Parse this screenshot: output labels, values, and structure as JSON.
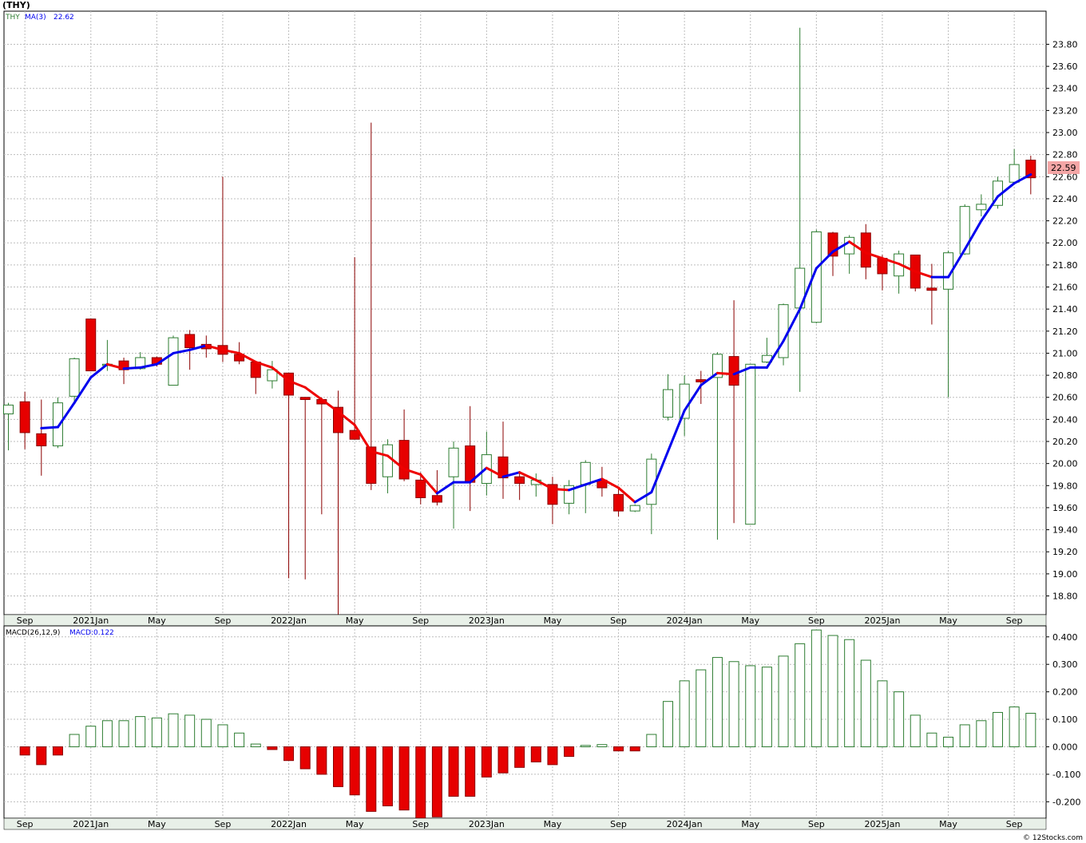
{
  "header": {
    "symbol_title": "(THY)",
    "price_legend_symbol": "THY",
    "ma_legend": "MA(3)",
    "ma_value": "22.62",
    "last_price_label": "22.59",
    "macd_legend": "MACD(26,12,9)",
    "macd_value_label": "MACD:0.122",
    "watermark": "© 12Stocks.com"
  },
  "colors": {
    "up_candle": "#2e7d32",
    "down_candle": "#e60000",
    "ma_up": "#0000ee",
    "ma_down": "#ee0000",
    "grid": "#bdbdbd",
    "last_price_bg": "#f4a6a6"
  },
  "x_axis": {
    "labels": [
      {
        "text": "Sep",
        "bar": 1
      },
      {
        "text": "2021Jan",
        "bar": 5
      },
      {
        "text": "May",
        "bar": 9
      },
      {
        "text": "Sep",
        "bar": 13
      },
      {
        "text": "2022Jan",
        "bar": 17
      },
      {
        "text": "May",
        "bar": 21
      },
      {
        "text": "Sep",
        "bar": 25
      },
      {
        "text": "2023Jan",
        "bar": 29
      },
      {
        "text": "May",
        "bar": 33
      },
      {
        "text": "Sep",
        "bar": 37
      },
      {
        "text": "2024Jan",
        "bar": 41
      },
      {
        "text": "May",
        "bar": 45
      },
      {
        "text": "Sep",
        "bar": 49
      },
      {
        "text": "2025Jan",
        "bar": 53
      },
      {
        "text": "May",
        "bar": 57
      },
      {
        "text": "Sep",
        "bar": 61
      }
    ]
  },
  "price_axis": {
    "min": 18.63,
    "max": 24.1,
    "ticks": [
      "18.80",
      "19.00",
      "19.20",
      "19.40",
      "19.60",
      "19.80",
      "20.00",
      "20.20",
      "20.40",
      "20.60",
      "20.80",
      "21.00",
      "21.20",
      "21.40",
      "21.60",
      "21.80",
      "22.00",
      "22.20",
      "22.40",
      "22.60",
      "22.80",
      "23.00",
      "23.20",
      "23.40",
      "23.60",
      "23.80"
    ]
  },
  "macd_axis": {
    "min": -0.26,
    "max": 0.44,
    "ticks": [
      "-0.200",
      "-0.100",
      "0.000",
      "0.100",
      "0.200",
      "0.300",
      "0.400"
    ]
  },
  "chart_data": [
    {
      "type": "candlestick",
      "title": "(THY)",
      "series_name": "THY",
      "period": "monthly",
      "candles": [
        {
          "o": 20.45,
          "h": 20.55,
          "l": 20.12,
          "c": 20.53
        },
        {
          "o": 20.56,
          "h": 20.65,
          "l": 20.13,
          "c": 20.28
        },
        {
          "o": 20.27,
          "h": 20.58,
          "l": 19.89,
          "c": 20.16
        },
        {
          "o": 20.16,
          "h": 20.6,
          "l": 20.14,
          "c": 20.55
        },
        {
          "o": 20.61,
          "h": 20.96,
          "l": 20.55,
          "c": 20.95
        },
        {
          "o": 21.31,
          "h": 21.31,
          "l": 20.84,
          "c": 20.84
        },
        {
          "o": 20.9,
          "h": 21.12,
          "l": 20.84,
          "c": 20.9
        },
        {
          "o": 20.93,
          "h": 20.96,
          "l": 20.72,
          "c": 20.85
        },
        {
          "o": 20.86,
          "h": 21.01,
          "l": 20.85,
          "c": 20.96
        },
        {
          "o": 20.96,
          "h": 20.97,
          "l": 20.88,
          "c": 20.9
        },
        {
          "o": 20.71,
          "h": 21.16,
          "l": 20.71,
          "c": 21.14
        },
        {
          "o": 21.17,
          "h": 21.21,
          "l": 20.85,
          "c": 21.05
        },
        {
          "o": 21.08,
          "h": 21.16,
          "l": 20.96,
          "c": 21.04
        },
        {
          "o": 21.07,
          "h": 22.6,
          "l": 20.92,
          "c": 20.99
        },
        {
          "o": 20.99,
          "h": 21.1,
          "l": 20.9,
          "c": 20.93
        },
        {
          "o": 20.92,
          "h": 20.93,
          "l": 20.63,
          "c": 20.78
        },
        {
          "o": 20.75,
          "h": 20.93,
          "l": 20.68,
          "c": 20.85
        },
        {
          "o": 20.82,
          "h": 20.82,
          "l": 18.96,
          "c": 20.62
        },
        {
          "o": 20.6,
          "h": 20.6,
          "l": 18.95,
          "c": 20.58
        },
        {
          "o": 20.58,
          "h": 20.6,
          "l": 19.54,
          "c": 20.54
        },
        {
          "o": 20.51,
          "h": 20.66,
          "l": 18.63,
          "c": 20.28
        },
        {
          "o": 20.3,
          "h": 21.87,
          "l": 20.22,
          "c": 20.22
        },
        {
          "o": 20.15,
          "h": 23.09,
          "l": 19.76,
          "c": 19.82
        },
        {
          "o": 19.88,
          "h": 20.22,
          "l": 19.73,
          "c": 20.17
        },
        {
          "o": 20.21,
          "h": 20.49,
          "l": 19.84,
          "c": 19.86
        },
        {
          "o": 19.85,
          "h": 19.92,
          "l": 19.63,
          "c": 19.69
        },
        {
          "o": 19.71,
          "h": 19.94,
          "l": 19.62,
          "c": 19.65
        },
        {
          "o": 19.88,
          "h": 20.2,
          "l": 19.41,
          "c": 20.14
        },
        {
          "o": 20.16,
          "h": 20.52,
          "l": 19.57,
          "c": 19.83
        },
        {
          "o": 19.82,
          "h": 20.29,
          "l": 19.71,
          "c": 20.08
        },
        {
          "o": 20.06,
          "h": 20.38,
          "l": 19.68,
          "c": 19.87
        },
        {
          "o": 19.88,
          "h": 19.93,
          "l": 19.67,
          "c": 19.82
        },
        {
          "o": 19.81,
          "h": 19.91,
          "l": 19.7,
          "c": 19.85
        },
        {
          "o": 19.81,
          "h": 19.88,
          "l": 19.45,
          "c": 19.63
        },
        {
          "o": 19.64,
          "h": 19.85,
          "l": 19.54,
          "c": 19.8
        },
        {
          "o": 19.81,
          "h": 20.03,
          "l": 19.55,
          "c": 20.01
        },
        {
          "o": 19.85,
          "h": 19.97,
          "l": 19.7,
          "c": 19.78
        },
        {
          "o": 19.72,
          "h": 19.77,
          "l": 19.52,
          "c": 19.57
        },
        {
          "o": 19.57,
          "h": 19.63,
          "l": 19.56,
          "c": 19.62
        },
        {
          "o": 19.63,
          "h": 20.09,
          "l": 19.36,
          "c": 20.04
        },
        {
          "o": 20.42,
          "h": 20.81,
          "l": 20.39,
          "c": 20.67
        },
        {
          "o": 20.41,
          "h": 20.8,
          "l": 20.25,
          "c": 20.72
        },
        {
          "o": 20.76,
          "h": 20.84,
          "l": 20.54,
          "c": 20.74
        },
        {
          "o": 20.78,
          "h": 21.01,
          "l": 19.31,
          "c": 20.99
        },
        {
          "o": 20.97,
          "h": 21.48,
          "l": 19.46,
          "c": 20.71
        },
        {
          "o": 19.45,
          "h": 20.9,
          "l": 19.45,
          "c": 20.9
        },
        {
          "o": 20.92,
          "h": 21.14,
          "l": 20.91,
          "c": 20.98
        },
        {
          "o": 20.96,
          "h": 21.45,
          "l": 20.89,
          "c": 21.44
        },
        {
          "o": 21.41,
          "h": 23.95,
          "l": 20.65,
          "c": 21.77
        },
        {
          "o": 21.28,
          "h": 22.12,
          "l": 21.27,
          "c": 22.1
        },
        {
          "o": 22.09,
          "h": 22.1,
          "l": 21.7,
          "c": 21.88
        },
        {
          "o": 21.9,
          "h": 22.07,
          "l": 21.72,
          "c": 22.05
        },
        {
          "o": 22.09,
          "h": 22.17,
          "l": 21.67,
          "c": 21.78
        },
        {
          "o": 21.86,
          "h": 21.89,
          "l": 21.57,
          "c": 21.72
        },
        {
          "o": 21.7,
          "h": 21.93,
          "l": 21.54,
          "c": 21.9
        },
        {
          "o": 21.89,
          "h": 21.89,
          "l": 21.56,
          "c": 21.59
        },
        {
          "o": 21.59,
          "h": 21.81,
          "l": 21.26,
          "c": 21.57
        },
        {
          "o": 21.58,
          "h": 21.93,
          "l": 20.6,
          "c": 21.91
        },
        {
          "o": 21.9,
          "h": 22.35,
          "l": 21.89,
          "c": 22.33
        },
        {
          "o": 22.3,
          "h": 22.44,
          "l": 22.24,
          "c": 22.35
        },
        {
          "o": 22.34,
          "h": 22.6,
          "l": 22.31,
          "c": 22.56
        },
        {
          "o": 22.55,
          "h": 22.85,
          "l": 22.54,
          "c": 22.71
        },
        {
          "o": 22.75,
          "h": 22.79,
          "l": 22.44,
          "c": 22.59
        }
      ],
      "ma3": [
        null,
        null,
        20.32,
        20.33,
        20.55,
        20.78,
        20.9,
        20.86,
        20.87,
        20.9,
        21.0,
        21.03,
        21.07,
        21.03,
        21.0,
        20.92,
        20.87,
        20.75,
        20.69,
        20.58,
        20.47,
        20.35,
        20.11,
        20.07,
        19.95,
        19.9,
        19.73,
        19.83,
        19.83,
        19.96,
        19.88,
        19.92,
        19.85,
        19.77,
        19.76,
        19.81,
        19.86,
        19.78,
        19.65,
        19.74,
        20.11,
        20.48,
        20.71,
        20.82,
        20.81,
        20.87,
        20.87,
        21.11,
        21.4,
        21.77,
        21.92,
        22.01,
        21.91,
        21.86,
        21.81,
        21.74,
        21.69,
        21.69,
        21.94,
        22.2,
        22.42,
        22.54,
        22.62
      ]
    },
    {
      "type": "bar",
      "title": "MACD(26,12,9)",
      "series_name": "MACD",
      "last_value": 0.122,
      "values": [
        null,
        -0.03,
        -0.065,
        -0.03,
        0.045,
        0.075,
        0.095,
        0.095,
        0.11,
        0.105,
        0.12,
        0.115,
        0.1,
        0.08,
        0.05,
        0.01,
        -0.01,
        -0.05,
        -0.08,
        -0.1,
        -0.145,
        -0.175,
        -0.235,
        -0.215,
        -0.23,
        -0.26,
        -0.255,
        -0.18,
        -0.18,
        -0.11,
        -0.095,
        -0.075,
        -0.055,
        -0.065,
        -0.035,
        0.005,
        0.008,
        -0.015,
        -0.015,
        0.045,
        0.165,
        0.24,
        0.28,
        0.325,
        0.31,
        0.295,
        0.29,
        0.33,
        0.375,
        0.425,
        0.405,
        0.39,
        0.315,
        0.24,
        0.2,
        0.115,
        0.05,
        0.035,
        0.08,
        0.095,
        0.125,
        0.145,
        0.122
      ]
    }
  ]
}
